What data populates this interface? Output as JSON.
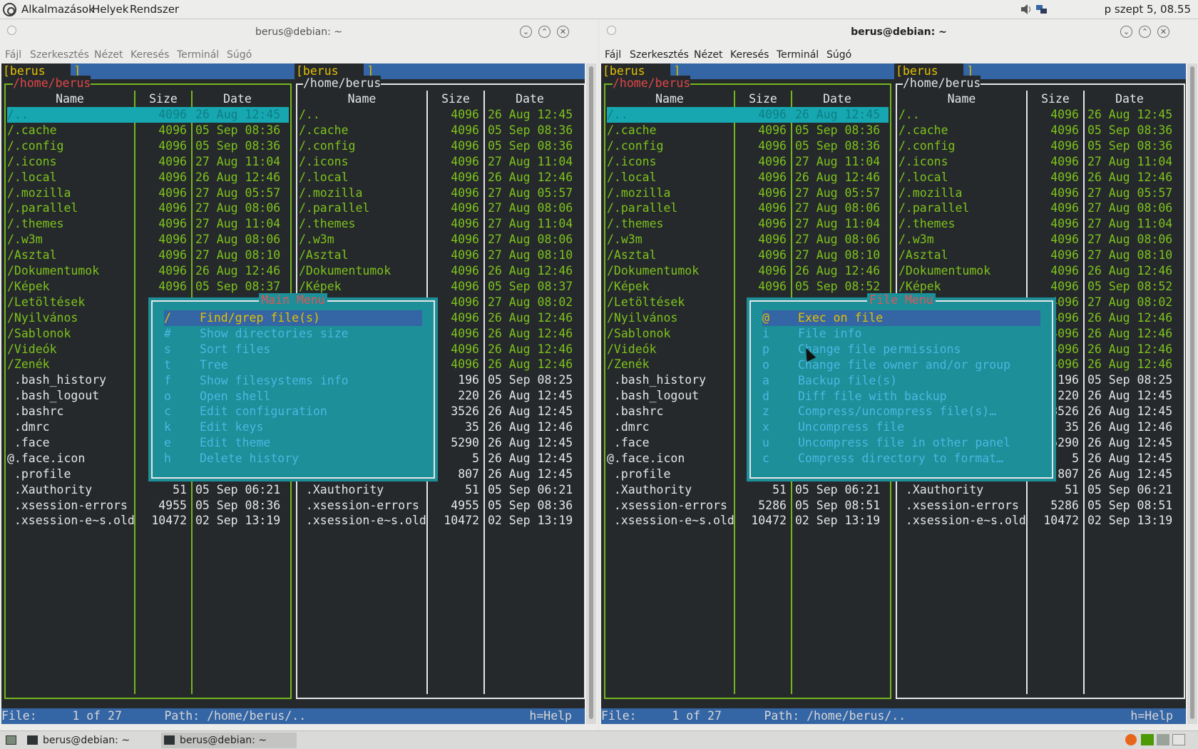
{
  "topbar": {
    "menus": [
      "Alkalmazások",
      "Helyek",
      "Rendszer"
    ],
    "clock": "p szept 5, 08.55"
  },
  "windows": [
    {
      "title": "berus@debian: ~",
      "menubar": [
        "Fájl",
        "Szerkesztés",
        "Nézet",
        "Keresés",
        "Terminál",
        "Súgó"
      ],
      "tabs": [
        "[berus    ]",
        "[berus    ]"
      ],
      "left_panel": {
        "path": "/home/berus",
        "rows": [
          [
            "/..",
            "4096",
            "26 Aug 12:45",
            "dir"
          ],
          [
            "/.cache",
            "4096",
            "05 Sep 08:36",
            "dir"
          ],
          [
            "/.config",
            "4096",
            "05 Sep 08:36",
            "dir"
          ],
          [
            "/.icons",
            "4096",
            "27 Aug 11:04",
            "dir"
          ],
          [
            "/.local",
            "4096",
            "26 Aug 12:46",
            "dir"
          ],
          [
            "/.mozilla",
            "4096",
            "27 Aug 05:57",
            "dir"
          ],
          [
            "/.parallel",
            "4096",
            "27 Aug 08:06",
            "dir"
          ],
          [
            "/.themes",
            "4096",
            "27 Aug 11:04",
            "dir"
          ],
          [
            "/.w3m",
            "4096",
            "27 Aug 08:06",
            "dir"
          ],
          [
            "/Asztal",
            "4096",
            "27 Aug 08:10",
            "dir"
          ],
          [
            "/Dokumentumok",
            "4096",
            "26 Aug 12:46",
            "dir"
          ],
          [
            "/Képek",
            "4096",
            "05 Sep 08:37",
            "dir"
          ],
          [
            "/Letöltések",
            "",
            "",
            "dir"
          ],
          [
            "/Nyilvános",
            "",
            "",
            "dir"
          ],
          [
            "/Sablonok",
            "",
            "",
            "dir"
          ],
          [
            "/Videók",
            "",
            "",
            "dir"
          ],
          [
            "/Zenék",
            "",
            "",
            "dir"
          ],
          [
            " .bash_history",
            "",
            "",
            "file"
          ],
          [
            " .bash_logout",
            "",
            "",
            "file"
          ],
          [
            " .bashrc",
            "",
            "",
            "file"
          ],
          [
            " .dmrc",
            "",
            "",
            "file"
          ],
          [
            " .face",
            "",
            "",
            "file"
          ],
          [
            "@.face.icon",
            "",
            "",
            "file"
          ],
          [
            " .profile",
            "",
            "",
            "file"
          ],
          [
            " .Xauthority",
            "51",
            "05 Sep 06:21",
            "file"
          ],
          [
            " .xsession-errors",
            "4955",
            "05 Sep 08:36",
            "file"
          ],
          [
            " .xsession-e~s.old",
            "10472",
            "02 Sep 13:19",
            "file"
          ]
        ]
      },
      "right_panel": {
        "path": "/home/berus",
        "rows": [
          [
            "/..",
            "4096",
            "26 Aug 12:45",
            "dir"
          ],
          [
            "/.cache",
            "4096",
            "05 Sep 08:36",
            "dir"
          ],
          [
            "/.config",
            "4096",
            "05 Sep 08:36",
            "dir"
          ],
          [
            "/.icons",
            "4096",
            "27 Aug 11:04",
            "dir"
          ],
          [
            "/.local",
            "4096",
            "26 Aug 12:46",
            "dir"
          ],
          [
            "/.mozilla",
            "4096",
            "27 Aug 05:57",
            "dir"
          ],
          [
            "/.parallel",
            "4096",
            "27 Aug 08:06",
            "dir"
          ],
          [
            "/.themes",
            "4096",
            "27 Aug 11:04",
            "dir"
          ],
          [
            "/.w3m",
            "4096",
            "27 Aug 08:06",
            "dir"
          ],
          [
            "/Asztal",
            "4096",
            "27 Aug 08:10",
            "dir"
          ],
          [
            "/Dokumentumok",
            "4096",
            "26 Aug 12:46",
            "dir"
          ],
          [
            "/Képek",
            "4096",
            "05 Sep 08:37",
            "dir"
          ],
          [
            "",
            "4096",
            "27 Aug 08:02",
            "dir"
          ],
          [
            "",
            "4096",
            "26 Aug 12:46",
            "dir"
          ],
          [
            "",
            "4096",
            "26 Aug 12:46",
            "dir"
          ],
          [
            "",
            "4096",
            "26 Aug 12:46",
            "dir"
          ],
          [
            "",
            "4096",
            "26 Aug 12:46",
            "dir"
          ],
          [
            "",
            "196",
            "05 Sep 08:25",
            "file"
          ],
          [
            "",
            "220",
            "26 Aug 12:45",
            "file"
          ],
          [
            "",
            "3526",
            "26 Aug 12:45",
            "file"
          ],
          [
            "",
            "35",
            "26 Aug 12:46",
            "file"
          ],
          [
            "",
            "5290",
            "26 Aug 12:45",
            "file"
          ],
          [
            "",
            "5",
            "26 Aug 12:45",
            "file"
          ],
          [
            "",
            "807",
            "26 Aug 12:45",
            "file"
          ],
          [
            " .Xauthority",
            "51",
            "05 Sep 06:21",
            "file"
          ],
          [
            " .xsession-errors",
            "4955",
            "05 Sep 08:36",
            "file"
          ],
          [
            " .xsession-e~s.old",
            "10472",
            "02 Sep 13:19",
            "file"
          ]
        ]
      },
      "popup": {
        "title": "Main Menu",
        "items": [
          [
            "/",
            "Find/grep file(s)"
          ],
          [
            "#",
            "Show directories size"
          ],
          [
            "s",
            "Sort files"
          ],
          [
            "t",
            "Tree"
          ],
          [
            "f",
            "Show filesystems info"
          ],
          [
            "o",
            "Open shell"
          ],
          [
            "c",
            "Edit configuration"
          ],
          [
            "k",
            "Edit keys"
          ],
          [
            "e",
            "Edit theme"
          ],
          [
            "h",
            "Delete history"
          ]
        ]
      },
      "status": "File:     1 of 27      Path: /home/berus/..",
      "help": "h=Help"
    },
    {
      "title": "berus@debian: ~",
      "menubar": [
        "Fájl",
        "Szerkesztés",
        "Nézet",
        "Keresés",
        "Terminál",
        "Súgó"
      ],
      "tabs": [
        "[berus    ]",
        "[berus    ]"
      ],
      "left_panel": {
        "path": "/home/berus",
        "rows": [
          [
            "/..",
            "4096",
            "26 Aug 12:45",
            "dir"
          ],
          [
            "/.cache",
            "4096",
            "05 Sep 08:36",
            "dir"
          ],
          [
            "/.config",
            "4096",
            "05 Sep 08:36",
            "dir"
          ],
          [
            "/.icons",
            "4096",
            "27 Aug 11:04",
            "dir"
          ],
          [
            "/.local",
            "4096",
            "26 Aug 12:46",
            "dir"
          ],
          [
            "/.mozilla",
            "4096",
            "27 Aug 05:57",
            "dir"
          ],
          [
            "/.parallel",
            "4096",
            "27 Aug 08:06",
            "dir"
          ],
          [
            "/.themes",
            "4096",
            "27 Aug 11:04",
            "dir"
          ],
          [
            "/.w3m",
            "4096",
            "27 Aug 08:06",
            "dir"
          ],
          [
            "/Asztal",
            "4096",
            "27 Aug 08:10",
            "dir"
          ],
          [
            "/Dokumentumok",
            "4096",
            "26 Aug 12:46",
            "dir"
          ],
          [
            "/Képek",
            "4096",
            "05 Sep 08:52",
            "dir"
          ],
          [
            "/Letöltések",
            "",
            "",
            "dir"
          ],
          [
            "/Nyilvános",
            "",
            "",
            "dir"
          ],
          [
            "/Sablonok",
            "",
            "",
            "dir"
          ],
          [
            "/Videók",
            "",
            "",
            "dir"
          ],
          [
            "/Zenék",
            "",
            "",
            "dir"
          ],
          [
            " .bash_history",
            "",
            "",
            "file"
          ],
          [
            " .bash_logout",
            "",
            "",
            "file"
          ],
          [
            " .bashrc",
            "",
            "",
            "file"
          ],
          [
            " .dmrc",
            "",
            "",
            "file"
          ],
          [
            " .face",
            "",
            "",
            "file"
          ],
          [
            "@.face.icon",
            "",
            "",
            "file"
          ],
          [
            " .profile",
            "",
            "",
            "file"
          ],
          [
            " .Xauthority",
            "51",
            "05 Sep 06:21",
            "file"
          ],
          [
            " .xsession-errors",
            "5286",
            "05 Sep 08:51",
            "file"
          ],
          [
            " .xsession-e~s.old",
            "10472",
            "02 Sep 13:19",
            "file"
          ]
        ]
      },
      "right_panel": {
        "path": "/home/berus",
        "rows": [
          [
            "/..",
            "4096",
            "26 Aug 12:45",
            "dir"
          ],
          [
            "/.cache",
            "4096",
            "05 Sep 08:36",
            "dir"
          ],
          [
            "/.config",
            "4096",
            "05 Sep 08:36",
            "dir"
          ],
          [
            "/.icons",
            "4096",
            "27 Aug 11:04",
            "dir"
          ],
          [
            "/.local",
            "4096",
            "26 Aug 12:46",
            "dir"
          ],
          [
            "/.mozilla",
            "4096",
            "27 Aug 05:57",
            "dir"
          ],
          [
            "/.parallel",
            "4096",
            "27 Aug 08:06",
            "dir"
          ],
          [
            "/.themes",
            "4096",
            "27 Aug 11:04",
            "dir"
          ],
          [
            "/.w3m",
            "4096",
            "27 Aug 08:06",
            "dir"
          ],
          [
            "/Asztal",
            "4096",
            "27 Aug 08:10",
            "dir"
          ],
          [
            "/Dokumentumok",
            "4096",
            "26 Aug 12:46",
            "dir"
          ],
          [
            "/Képek",
            "4096",
            "05 Sep 08:52",
            "dir"
          ],
          [
            "",
            "4096",
            "27 Aug 08:02",
            "dir"
          ],
          [
            "",
            "4096",
            "26 Aug 12:46",
            "dir"
          ],
          [
            "",
            "4096",
            "26 Aug 12:46",
            "dir"
          ],
          [
            "",
            "4096",
            "26 Aug 12:46",
            "dir"
          ],
          [
            "",
            "4096",
            "26 Aug 12:46",
            "dir"
          ],
          [
            "",
            "196",
            "05 Sep 08:25",
            "file"
          ],
          [
            "",
            "220",
            "26 Aug 12:45",
            "file"
          ],
          [
            "",
            "3526",
            "26 Aug 12:45",
            "file"
          ],
          [
            "",
            "35",
            "26 Aug 12:46",
            "file"
          ],
          [
            "",
            "5290",
            "26 Aug 12:45",
            "file"
          ],
          [
            "",
            "5",
            "26 Aug 12:45",
            "file"
          ],
          [
            "",
            "807",
            "26 Aug 12:45",
            "file"
          ],
          [
            " .Xauthority",
            "51",
            "05 Sep 06:21",
            "file"
          ],
          [
            " .xsession-errors",
            "5286",
            "05 Sep 08:51",
            "file"
          ],
          [
            " .xsession-e~s.old",
            "10472",
            "02 Sep 13:19",
            "file"
          ]
        ]
      },
      "popup": {
        "title": "File Menu",
        "items": [
          [
            "@",
            "Exec on file"
          ],
          [
            "i",
            "File info"
          ],
          [
            "p",
            "Change file permissions"
          ],
          [
            "o",
            "Change file owner and/or group"
          ],
          [
            "a",
            "Backup file(s)"
          ],
          [
            "d",
            "Diff file with backup"
          ],
          [
            "z",
            "Compress/uncompress file(s)…"
          ],
          [
            "x",
            "Uncompress file"
          ],
          [
            "u",
            "Uncompress file in other panel"
          ],
          [
            "c",
            "Compress directory to format…"
          ]
        ]
      },
      "status": "File:     1 of 27      Path: /home/berus/..",
      "help": "h=Help"
    }
  ],
  "columns": {
    "name": "Name",
    "size": "Size",
    "date": "Date"
  },
  "taskbar": {
    "tasks": [
      "berus@debian: ~",
      "berus@debian: ~"
    ]
  }
}
